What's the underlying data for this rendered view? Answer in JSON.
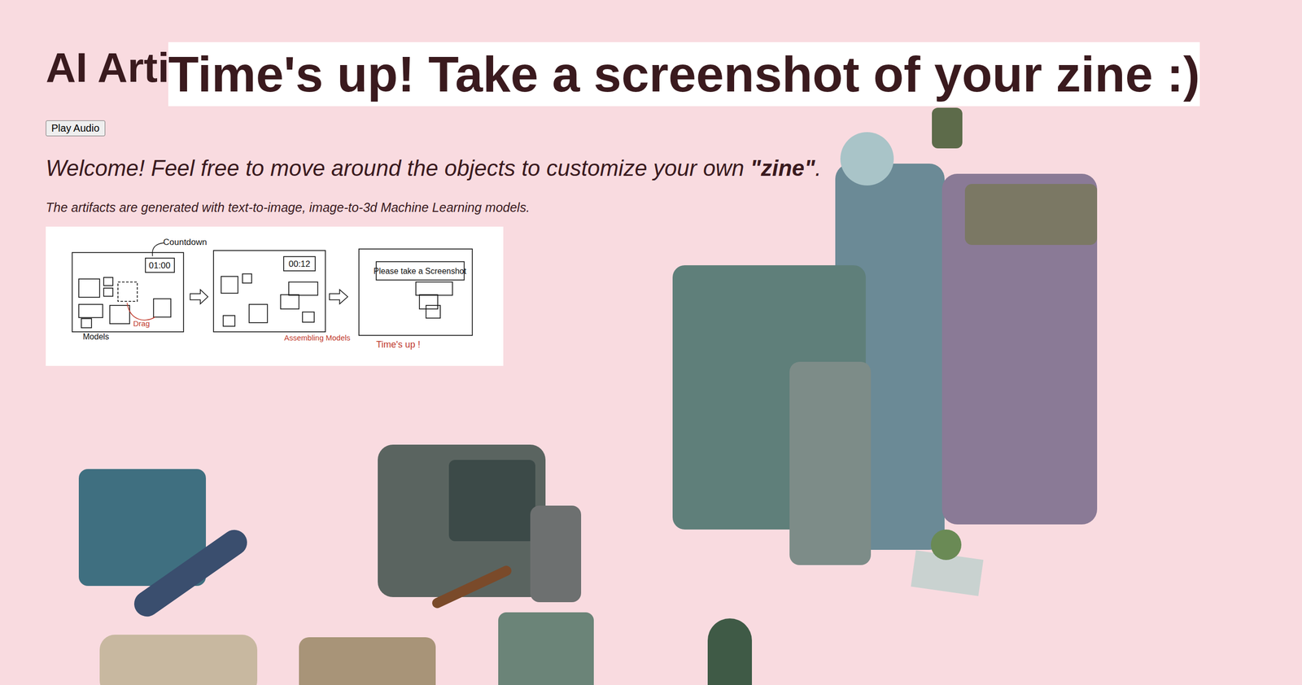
{
  "heading": "AI Arti",
  "overlay": {
    "message": "Time's up! Take a screenshot of your zine :)"
  },
  "play_button": "Play Audio",
  "welcome": {
    "before": "Welcome! Feel free to move around the objects to customize your own ",
    "emphasis": "\"zine\"",
    "after": "."
  },
  "note": "The artifacts are generated with text-to-image, image-to-3d Machine Learning models.",
  "diagram": {
    "countdown_label": "Countdown",
    "timer_start": "01:00",
    "models_label": "Models",
    "drag_label": "Drag",
    "timer_mid": "00:12",
    "assembling_label": "Assembling Models",
    "screenshot_prompt": "Please take a Screenshot",
    "times_up": "Time's up !"
  }
}
